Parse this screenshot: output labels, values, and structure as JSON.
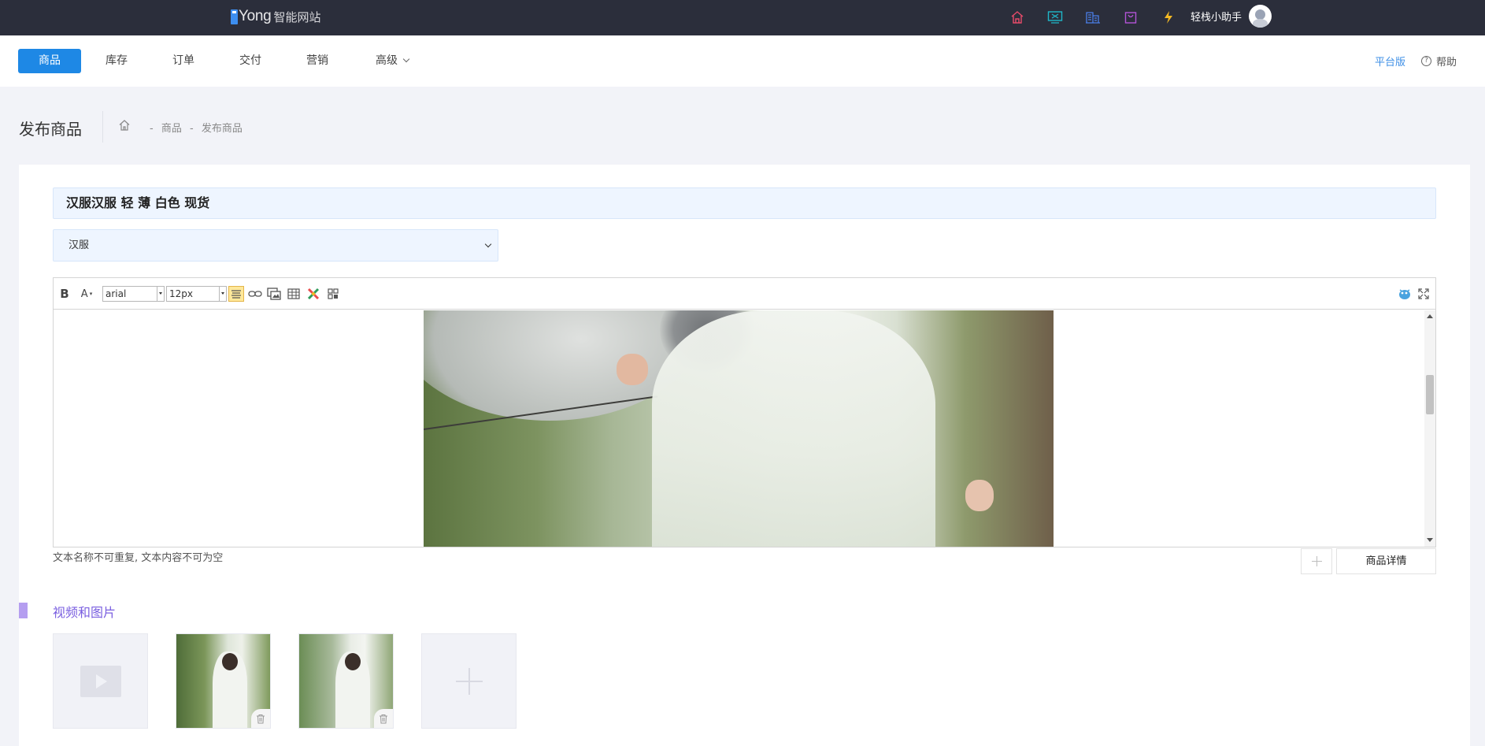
{
  "topbar": {
    "logo_brand": "Yong",
    "logo_text": "智能网站",
    "icons": [
      {
        "name": "home-icon",
        "color": "#e84b6a"
      },
      {
        "name": "monitor-icon",
        "color": "#1fb7c9"
      },
      {
        "name": "building-icon",
        "color": "#4a7ee8"
      },
      {
        "name": "shopping-bag-icon",
        "color": "#b354d6"
      },
      {
        "name": "lightning-icon",
        "color": "#f5b923"
      }
    ],
    "assistant_label": "轻栈小助手"
  },
  "nav": {
    "items": [
      {
        "label": "商品",
        "active": true
      },
      {
        "label": "库存"
      },
      {
        "label": "订单"
      },
      {
        "label": "交付"
      },
      {
        "label": "营销"
      },
      {
        "label": "高级"
      }
    ],
    "platform_label": "平台版",
    "help_label": "帮助",
    "help_glyph": "?"
  },
  "page": {
    "title": "发布商品",
    "breadcrumb": [
      "-",
      "商品",
      "-",
      "发布商品"
    ]
  },
  "form": {
    "product_title": "汉服汉服 轻 薄 白色 现货",
    "category_selected": "汉服"
  },
  "editor": {
    "bold_label": "B",
    "font_color_label": "A",
    "font_family": "arial",
    "font_size": "12px",
    "hint": "文本名称不可重复, 文本内容不可为空",
    "tab_label": "商品详情",
    "accent_color": "#1e88e5"
  },
  "media": {
    "section_title": "视频和图片"
  }
}
